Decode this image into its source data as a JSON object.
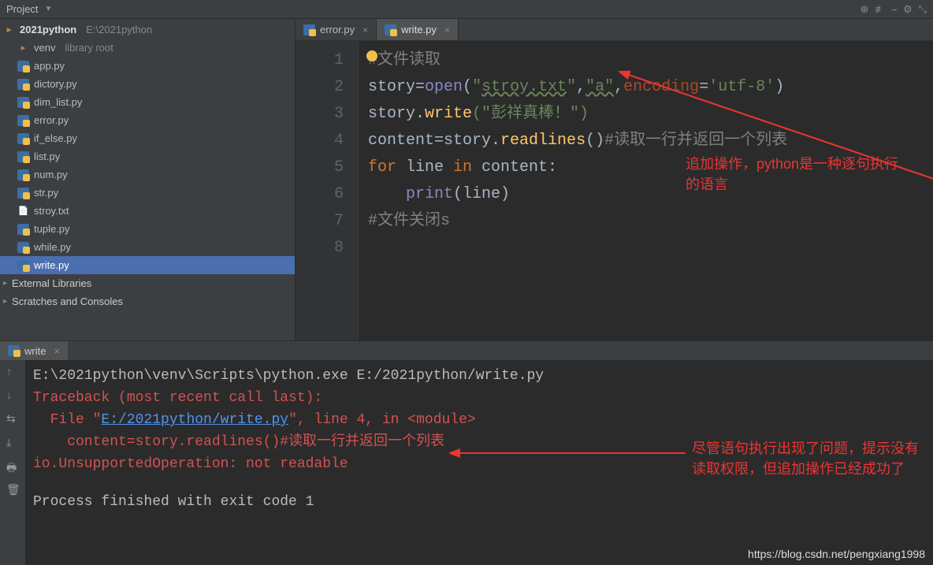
{
  "projectBar": {
    "label": "Project",
    "icons": [
      "⊕",
      "≢",
      "⎯",
      "⚙",
      "⤡"
    ]
  },
  "tree": {
    "root": {
      "name": "2021python",
      "path": "E:\\2021python"
    },
    "venv": {
      "name": "venv",
      "note": "library root"
    },
    "files": [
      {
        "name": "app.py",
        "kind": "py"
      },
      {
        "name": "dictory.py",
        "kind": "py"
      },
      {
        "name": "dim_list.py",
        "kind": "py"
      },
      {
        "name": "error.py",
        "kind": "py"
      },
      {
        "name": "if_else.py",
        "kind": "py"
      },
      {
        "name": "list.py",
        "kind": "py"
      },
      {
        "name": "num.py",
        "kind": "py"
      },
      {
        "name": "str.py",
        "kind": "py"
      },
      {
        "name": "stroy.txt",
        "kind": "txt"
      },
      {
        "name": "tuple.py",
        "kind": "py"
      },
      {
        "name": "while.py",
        "kind": "py"
      },
      {
        "name": "write.py",
        "kind": "py",
        "selected": true
      }
    ],
    "external": "External Libraries",
    "scratches": "Scratches and Consoles"
  },
  "editor": {
    "tabs": [
      {
        "name": "error.py",
        "active": false
      },
      {
        "name": "write.py",
        "active": true
      }
    ],
    "lines": [
      "1",
      "2",
      "3",
      "4",
      "5",
      "6",
      "7",
      "8"
    ],
    "code": {
      "l1_comment": "#文件读取",
      "l2_var": "story",
      "l2_eq": "=",
      "l2_open": "open",
      "l2_p1": "(",
      "l2_s1": "\"",
      "l2_link": "stroy.txt",
      "l2_s1b": "\"",
      "l2_c1": ",",
      "l2_arg": "\"a\"",
      "l2_c2": ",",
      "l2_kw": "encoding",
      "l2_kweq": "=",
      "l2_enc": "'utf-8'",
      "l2_p2": ")",
      "l3": "story.",
      "l3_fn": "write",
      "l3_rest": "(\"彭祥真棒！\")",
      "l4_a": "content",
      "l4_eq": "=",
      "l4_b": "story.",
      "l4_fn": "readlines",
      "l4_p": "()",
      "l4_cmt": "#读取一行并返回一个列表",
      "l5_for": "for ",
      "l5_var": "line ",
      "l5_in": "in ",
      "l5_c": "content:",
      "l6_ind": "    ",
      "l6_fn": "print",
      "l6_p": "(line)",
      "l7": "#文件关闭s"
    }
  },
  "annotations": {
    "a1": "追加操作，python是一种逐句执行的语言",
    "a2": "尽管语句执行出现了问题，提示没有读取权限，但追加操作已经成功了"
  },
  "run": {
    "tab": "write",
    "lines": {
      "cmd": "E:\\2021python\\venv\\Scripts\\python.exe E:/2021python/write.py",
      "tb1": "Traceback (most recent call last):",
      "tb2a": "  File \"",
      "tb2link": "E:/2021python/write.py",
      "tb2b": "\", line 4, in <module>",
      "tb3": "    content=story.readlines()#读取一行并返回一个列表",
      "tb4": "io.UnsupportedOperation: not readable",
      "exit": "Process finished with exit code 1"
    }
  },
  "watermark": "https://blog.csdn.net/pengxiang1998"
}
